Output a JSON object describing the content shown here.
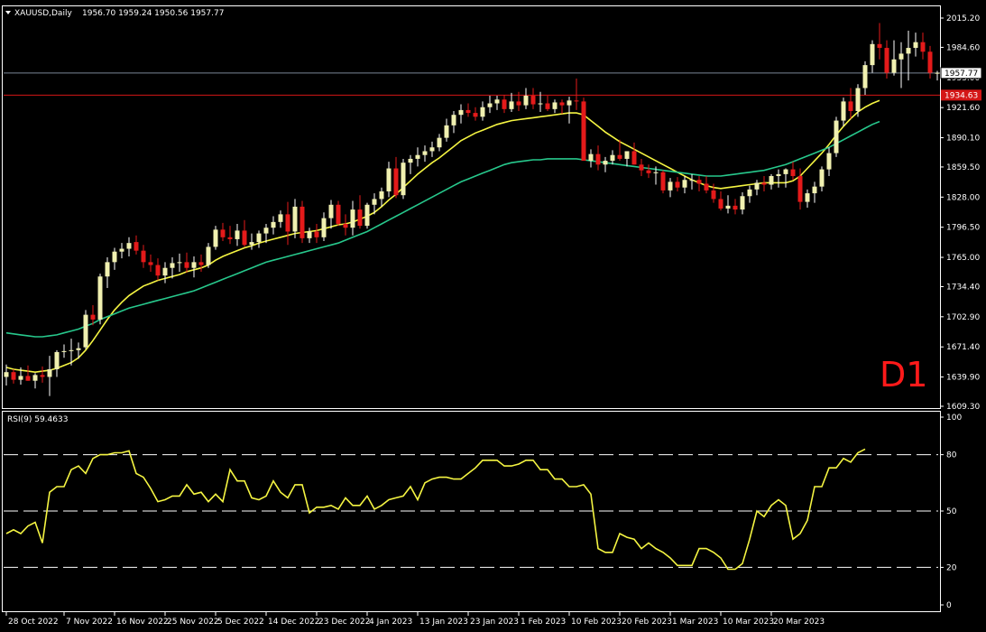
{
  "header": {
    "symbol": "XAUUSD,Daily",
    "ohlc": "1956.70 1959.24 1950.56 1957.77"
  },
  "timeframe_label": "D1",
  "rsi_label": "RSI(9) 59.4633",
  "colors": {
    "background": "#000000",
    "bull_candle": "#f0f0b0",
    "bear_candle": "#e41a1a",
    "ma_fast": "#f5f542",
    "ma_slow": "#27c88c",
    "rsi_line": "#f5f542",
    "bid_line": "#7a8596",
    "alert_line": "#d41616",
    "axis_text": "#ffffff",
    "d1_label": "#ff1a1a"
  },
  "chart_data": [
    {
      "type": "candlestick",
      "title": "XAUUSD,Daily",
      "ylim": [
        1609.3,
        2015.2
      ],
      "y_ticks": [
        2015.2,
        1984.6,
        1953.0,
        1921.6,
        1890.1,
        1859.5,
        1828.0,
        1796.5,
        1765.0,
        1734.4,
        1702.9,
        1671.4,
        1639.9,
        1609.3
      ],
      "x_ticks": [
        "28 Oct 2022",
        "7 Nov 2022",
        "16 Nov 2022",
        "25 Nov 2022",
        "5 Dec 2022",
        "14 Dec 2022",
        "23 Dec 2022",
        "4 Jan 2023",
        "13 Jan 2023",
        "23 Jan 2023",
        "1 Feb 2023",
        "10 Feb 2023",
        "20 Feb 2023",
        "1 Mar 2023",
        "10 Mar 2023",
        "20 Mar 2023"
      ],
      "x_tick_bar_index": [
        0,
        8,
        15,
        22,
        29,
        36,
        43,
        50,
        57,
        64,
        71,
        78,
        85,
        92,
        99,
        106
      ],
      "price_tags": [
        {
          "name": "bid",
          "value": 1957.77,
          "label": "1957.77"
        },
        {
          "name": "alert",
          "value": 1934.63,
          "label": "1934.63"
        }
      ],
      "candles": [
        [
          1640,
          1653,
          1631,
          1645
        ],
        [
          1645,
          1648,
          1633,
          1637
        ],
        [
          1637,
          1650,
          1632,
          1641
        ],
        [
          1641,
          1652,
          1636,
          1636
        ],
        [
          1636,
          1644,
          1628,
          1642
        ],
        [
          1642,
          1651,
          1634,
          1640
        ],
        [
          1640,
          1662,
          1620,
          1648
        ],
        [
          1648,
          1668,
          1640,
          1666
        ],
        [
          1666,
          1674,
          1660,
          1667
        ],
        [
          1667,
          1680,
          1652,
          1668
        ],
        [
          1668,
          1676,
          1659,
          1670
        ],
        [
          1671,
          1710,
          1669,
          1705
        ],
        [
          1705,
          1715,
          1694,
          1700
        ],
        [
          1700,
          1748,
          1695,
          1745
        ],
        [
          1745,
          1765,
          1733,
          1760
        ],
        [
          1760,
          1775,
          1752,
          1771
        ],
        [
          1771,
          1780,
          1764,
          1774
        ],
        [
          1774,
          1786,
          1766,
          1780
        ],
        [
          1781,
          1788,
          1768,
          1772
        ],
        [
          1772,
          1778,
          1754,
          1760
        ],
        [
          1760,
          1768,
          1750,
          1757
        ],
        [
          1757,
          1764,
          1741,
          1746
        ],
        [
          1746,
          1760,
          1738,
          1754
        ],
        [
          1754,
          1765,
          1743,
          1759
        ],
        [
          1759,
          1769,
          1750,
          1760
        ],
        [
          1760,
          1770,
          1749,
          1754
        ],
        [
          1754,
          1766,
          1744,
          1760
        ],
        [
          1760,
          1768,
          1750,
          1757
        ],
        [
          1757,
          1780,
          1754,
          1776
        ],
        [
          1776,
          1798,
          1773,
          1794
        ],
        [
          1794,
          1801,
          1782,
          1786
        ],
        [
          1786,
          1798,
          1779,
          1784
        ],
        [
          1784,
          1800,
          1777,
          1793
        ],
        [
          1793,
          1804,
          1776,
          1778
        ],
        [
          1778,
          1790,
          1773,
          1781
        ],
        [
          1781,
          1793,
          1775,
          1790
        ],
        [
          1790,
          1800,
          1780,
          1796
        ],
        [
          1796,
          1808,
          1789,
          1802
        ],
        [
          1802,
          1814,
          1796,
          1810
        ],
        [
          1810,
          1823,
          1778,
          1792
        ],
        [
          1792,
          1826,
          1785,
          1818
        ],
        [
          1818,
          1824,
          1780,
          1785
        ],
        [
          1785,
          1796,
          1780,
          1792
        ],
        [
          1792,
          1800,
          1780,
          1786
        ],
        [
          1786,
          1812,
          1782,
          1806
        ],
        [
          1806,
          1825,
          1795,
          1820
        ],
        [
          1820,
          1824,
          1798,
          1800
        ],
        [
          1800,
          1810,
          1788,
          1796
        ],
        [
          1796,
          1824,
          1788,
          1815
        ],
        [
          1815,
          1830,
          1795,
          1798
        ],
        [
          1798,
          1822,
          1795,
          1820
        ],
        [
          1820,
          1832,
          1810,
          1826
        ],
        [
          1826,
          1838,
          1818,
          1834
        ],
        [
          1834,
          1865,
          1828,
          1858
        ],
        [
          1858,
          1870,
          1827,
          1830
        ],
        [
          1830,
          1868,
          1826,
          1864
        ],
        [
          1864,
          1872,
          1852,
          1868
        ],
        [
          1868,
          1880,
          1860,
          1872
        ],
        [
          1872,
          1882,
          1865,
          1876
        ],
        [
          1876,
          1886,
          1870,
          1880
        ],
        [
          1880,
          1894,
          1876,
          1890
        ],
        [
          1890,
          1910,
          1886,
          1903
        ],
        [
          1903,
          1918,
          1895,
          1914
        ],
        [
          1914,
          1925,
          1905,
          1919
        ],
        [
          1919,
          1926,
          1912,
          1916
        ],
        [
          1916,
          1922,
          1908,
          1912
        ],
        [
          1912,
          1928,
          1908,
          1922
        ],
        [
          1922,
          1934,
          1916,
          1926
        ],
        [
          1926,
          1934,
          1919,
          1930
        ],
        [
          1930,
          1935,
          1916,
          1920
        ],
        [
          1920,
          1937,
          1917,
          1928
        ],
        [
          1928,
          1938,
          1918,
          1924
        ],
        [
          1924,
          1942,
          1920,
          1934
        ],
        [
          1934,
          1942,
          1920,
          1925
        ],
        [
          1925,
          1938,
          1917,
          1926
        ],
        [
          1926,
          1934,
          1918,
          1920
        ],
        [
          1920,
          1930,
          1916,
          1927
        ],
        [
          1927,
          1930,
          1915,
          1924
        ],
        [
          1924,
          1933,
          1905,
          1929
        ],
        [
          1929,
          1952,
          1919,
          1928
        ],
        [
          1928,
          1932,
          1910,
          1866
        ],
        [
          1866,
          1878,
          1859,
          1873
        ],
        [
          1873,
          1882,
          1856,
          1862
        ],
        [
          1862,
          1870,
          1854,
          1866
        ],
        [
          1866,
          1877,
          1862,
          1872
        ],
        [
          1872,
          1888,
          1866,
          1868
        ],
        [
          1868,
          1876,
          1860,
          1876
        ],
        [
          1876,
          1885,
          1862,
          1862
        ],
        [
          1862,
          1868,
          1850,
          1856
        ],
        [
          1856,
          1862,
          1848,
          1853
        ],
        [
          1853,
          1860,
          1841,
          1854
        ],
        [
          1854,
          1856,
          1832,
          1835
        ],
        [
          1835,
          1848,
          1828,
          1844
        ],
        [
          1844,
          1849,
          1834,
          1838
        ],
        [
          1838,
          1850,
          1832,
          1846
        ],
        [
          1846,
          1852,
          1836,
          1846
        ],
        [
          1846,
          1850,
          1834,
          1842
        ],
        [
          1842,
          1850,
          1832,
          1835
        ],
        [
          1835,
          1842,
          1822,
          1826
        ],
        [
          1826,
          1834,
          1814,
          1816
        ],
        [
          1816,
          1830,
          1811,
          1819
        ],
        [
          1819,
          1826,
          1810,
          1815
        ],
        [
          1815,
          1833,
          1810,
          1829
        ],
        [
          1829,
          1840,
          1822,
          1836
        ],
        [
          1836,
          1846,
          1830,
          1843
        ],
        [
          1843,
          1850,
          1834,
          1841
        ],
        [
          1841,
          1852,
          1836,
          1850
        ],
        [
          1850,
          1857,
          1838,
          1852
        ],
        [
          1852,
          1858,
          1838,
          1857
        ],
        [
          1857,
          1865,
          1846,
          1850
        ],
        [
          1850,
          1858,
          1815,
          1823
        ],
        [
          1823,
          1836,
          1817,
          1832
        ],
        [
          1832,
          1844,
          1822,
          1839
        ],
        [
          1839,
          1860,
          1834,
          1857
        ],
        [
          1857,
          1880,
          1850,
          1874
        ],
        [
          1874,
          1912,
          1870,
          1908
        ],
        [
          1908,
          1932,
          1902,
          1928
        ],
        [
          1928,
          1942,
          1910,
          1918
        ],
        [
          1918,
          1946,
          1912,
          1942
        ],
        [
          1942,
          1970,
          1935,
          1966
        ],
        [
          1966,
          1992,
          1958,
          1988
        ],
        [
          1988,
          2010,
          1972,
          1984
        ],
        [
          1984,
          1992,
          1952,
          1958
        ],
        [
          1958,
          1992,
          1955,
          1972
        ],
        [
          1972,
          1990,
          1942,
          1978
        ],
        [
          1978,
          2002,
          1950,
          1984
        ],
        [
          1984,
          2000,
          1975,
          1990
        ],
        [
          1990,
          2000,
          1972,
          1980
        ],
        [
          1980,
          1986,
          1952,
          1958
        ],
        [
          1957,
          1960,
          1950,
          1958
        ]
      ],
      "series": [
        {
          "name": "",
          "values": [
            1650,
            1648,
            1647,
            1646,
            1645,
            1646,
            1647,
            1649,
            1652,
            1655,
            1660,
            1668,
            1678,
            1689,
            1700,
            1710,
            1718,
            1725,
            1730,
            1735,
            1738,
            1741,
            1743,
            1745,
            1747,
            1750,
            1752,
            1754,
            1757,
            1762,
            1766,
            1769,
            1772,
            1775,
            1777,
            1780,
            1782,
            1784,
            1786,
            1788,
            1790,
            1791,
            1792,
            1793,
            1795,
            1797,
            1799,
            1800,
            1802,
            1805,
            1808,
            1812,
            1818,
            1825,
            1831,
            1838,
            1845,
            1852,
            1858,
            1864,
            1869,
            1875,
            1881,
            1887,
            1891,
            1895,
            1898,
            1901,
            1904,
            1906,
            1908,
            1909,
            1910,
            1911,
            1912,
            1913,
            1914,
            1915,
            1916,
            1916,
            1914,
            1908,
            1902,
            1896,
            1891,
            1886,
            1882,
            1878,
            1874,
            1870,
            1866,
            1862,
            1858,
            1854,
            1850,
            1846,
            1843,
            1840,
            1838,
            1837,
            1838,
            1839,
            1840,
            1841,
            1842,
            1843,
            1843,
            1843,
            1843,
            1845,
            1850,
            1858,
            1866,
            1874,
            1883,
            1893,
            1902,
            1910,
            1917,
            1922,
            1926,
            1929
          ]
        },
        {
          "name": "",
          "values": [
            1686,
            1685,
            1684,
            1683,
            1682,
            1682,
            1683,
            1684,
            1686,
            1688,
            1690,
            1693,
            1696,
            1700,
            1703,
            1706,
            1709,
            1712,
            1714,
            1716,
            1718,
            1720,
            1722,
            1724,
            1726,
            1728,
            1730,
            1733,
            1736,
            1739,
            1742,
            1745,
            1748,
            1751,
            1754,
            1757,
            1760,
            1762,
            1764,
            1766,
            1768,
            1770,
            1772,
            1774,
            1776,
            1778,
            1780,
            1783,
            1786,
            1789,
            1792,
            1796,
            1800,
            1804,
            1808,
            1812,
            1816,
            1820,
            1824,
            1828,
            1832,
            1836,
            1840,
            1844,
            1847,
            1850,
            1853,
            1856,
            1859,
            1862,
            1864,
            1865,
            1866,
            1867,
            1867,
            1868,
            1868,
            1868,
            1868,
            1868,
            1867,
            1866,
            1865,
            1864,
            1863,
            1862,
            1861,
            1860,
            1859,
            1858,
            1857,
            1856,
            1855,
            1854,
            1853,
            1852,
            1851,
            1850,
            1850,
            1850,
            1851,
            1852,
            1853,
            1854,
            1855,
            1856,
            1858,
            1860,
            1862,
            1865,
            1868,
            1871,
            1874,
            1877,
            1880,
            1884,
            1888,
            1892,
            1896,
            1900,
            1904,
            1907
          ]
        }
      ]
    },
    {
      "type": "line",
      "title": "RSI(9) 59.4633",
      "ylim": [
        0,
        100
      ],
      "y_ticks": [
        100,
        80,
        50,
        20,
        0
      ],
      "levels": [
        80,
        50,
        20
      ],
      "series": [
        {
          "name": "",
          "values": [
            38,
            40,
            38,
            42,
            44,
            33,
            60,
            63,
            63,
            72,
            74,
            70,
            78,
            80,
            80,
            81,
            81,
            82,
            70,
            68,
            62,
            55,
            56,
            58,
            58,
            64,
            59,
            60,
            55,
            59,
            55,
            72,
            66,
            66,
            57,
            56,
            58,
            66,
            60,
            57,
            64,
            64,
            49,
            52,
            52,
            53,
            51,
            57,
            53,
            53,
            58,
            51,
            53,
            56,
            57,
            58,
            63,
            56,
            65,
            67,
            68,
            68,
            67,
            67,
            70,
            73,
            77,
            77,
            77,
            74,
            74,
            75,
            77,
            77,
            72,
            72,
            67,
            67,
            63,
            63,
            64,
            59,
            30,
            28,
            28,
            38,
            36,
            35,
            30,
            33,
            30,
            28,
            25,
            21,
            21,
            21,
            30,
            30,
            28,
            25,
            19,
            19,
            22,
            35,
            50,
            47,
            53,
            56,
            53,
            35,
            38,
            45,
            63,
            63,
            73,
            73,
            78,
            76,
            81,
            83
          ]
        }
      ]
    }
  ]
}
